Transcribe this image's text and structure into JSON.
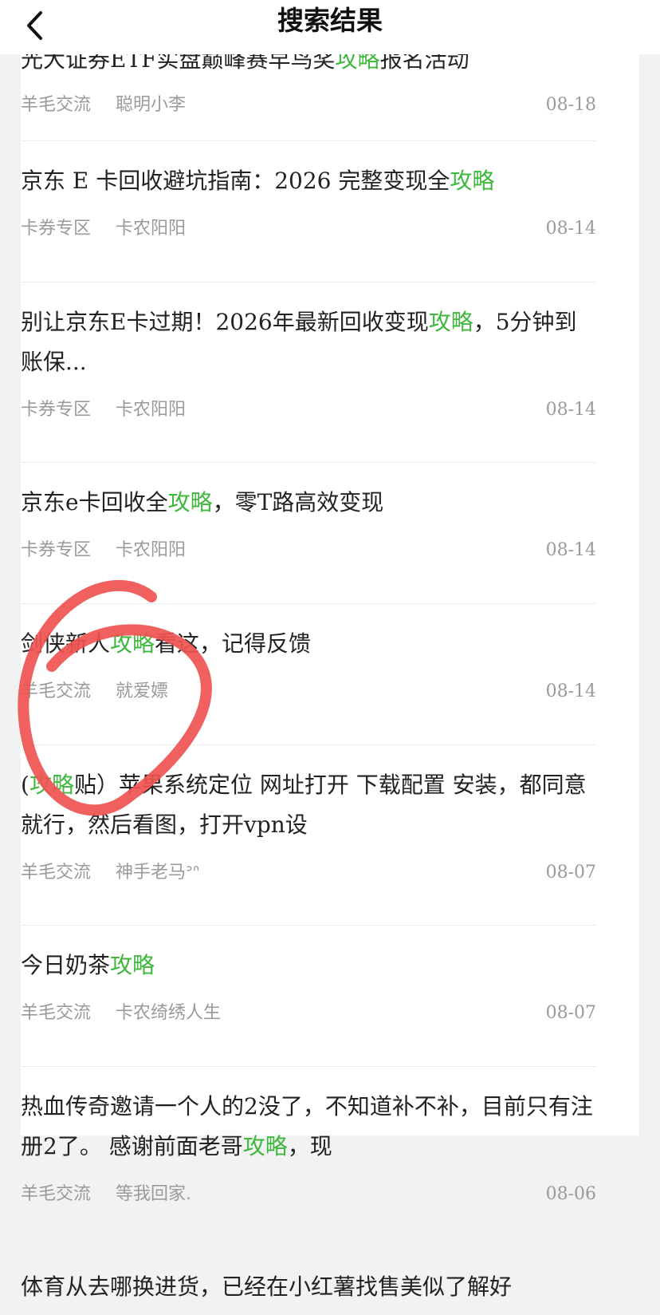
{
  "header": {
    "title": "搜索结果"
  },
  "results": [
    {
      "title": [
        {
          "t": "光大证券ETF实盘巅峰赛早鸟奖",
          "h": false
        },
        {
          "t": "攻略",
          "h": true
        },
        {
          "t": "报名活动",
          "h": false
        }
      ],
      "category": "羊毛交流",
      "author": "聪明小李",
      "date": "08-18"
    },
    {
      "title": [
        {
          "t": "京东 E 卡回收避坑指南：2026 完整变现全",
          "h": false
        },
        {
          "t": "攻略",
          "h": true
        }
      ],
      "category": "卡券专区",
      "author": "卡农阳阳",
      "date": "08-14"
    },
    {
      "title": [
        {
          "t": "别让京东E卡过期！2026年最新回收变现",
          "h": false
        },
        {
          "t": "攻略",
          "h": true
        },
        {
          "t": "，5分钟到账保...",
          "h": false
        }
      ],
      "category": "卡券专区",
      "author": "卡农阳阳",
      "date": "08-14"
    },
    {
      "title": [
        {
          "t": "京东e卡回收全",
          "h": false
        },
        {
          "t": "攻略",
          "h": true
        },
        {
          "t": "，零T路高效变现",
          "h": false
        }
      ],
      "category": "卡券专区",
      "author": "卡农阳阳",
      "date": "08-14"
    },
    {
      "title": [
        {
          "t": "剑侠新人",
          "h": false
        },
        {
          "t": "攻略",
          "h": true
        },
        {
          "t": "看这，记得反馈",
          "h": false
        }
      ],
      "category": "羊毛交流",
      "author": "就爱嫖",
      "date": "08-14"
    },
    {
      "title": [
        {
          "t": "(",
          "h": false
        },
        {
          "t": "攻略",
          "h": true
        },
        {
          "t": "贴）苹果系统定位 网址打开 下载配置 安装，都同意就行，然后看图，打开vpn设",
          "h": false
        }
      ],
      "category": "羊毛交流",
      "author": "神手老马ᐣᐢ",
      "date": "08-07"
    },
    {
      "title": [
        {
          "t": "今日奶茶",
          "h": false
        },
        {
          "t": "攻略",
          "h": true
        }
      ],
      "category": "羊毛交流",
      "author": "卡农绮绣人生",
      "date": "08-07"
    },
    {
      "title": [
        {
          "t": "热血传奇邀请一个人的2没了，不知道补不补，目前只有注册2了。 感谢前面老哥",
          "h": false
        },
        {
          "t": "攻略",
          "h": true
        },
        {
          "t": "，现",
          "h": false
        }
      ],
      "category": "羊毛交流",
      "author": "等我回家.",
      "date": "08-06"
    },
    {
      "title": [
        {
          "t": "体育从去哪换进货，已经在小红薯找售美似了解好",
          "h": false
        }
      ],
      "category": "",
      "author": "",
      "date": ""
    }
  ],
  "colors": {
    "highlight": "#3db83d",
    "annotation": "#ef5350"
  }
}
